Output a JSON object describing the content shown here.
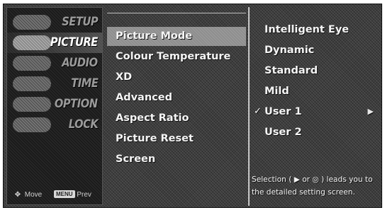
{
  "sidebar": {
    "categories": [
      {
        "label": "SETUP",
        "icon": "setup-icon"
      },
      {
        "label": "PICTURE",
        "icon": "picture-icon",
        "active": true
      },
      {
        "label": "AUDIO",
        "icon": "audio-icon"
      },
      {
        "label": "TIME",
        "icon": "time-icon"
      },
      {
        "label": "OPTION",
        "icon": "option-icon"
      },
      {
        "label": "LOCK",
        "icon": "lock-icon"
      }
    ]
  },
  "footer": {
    "move_icon": "✥",
    "move_label": "Move",
    "menu_badge": "MENU",
    "prev_label": "Prev"
  },
  "menu": {
    "items": [
      {
        "label": "Picture Mode",
        "selected": true
      },
      {
        "label": "Colour Temperature"
      },
      {
        "label": "XD"
      },
      {
        "label": "Advanced"
      },
      {
        "label": "Aspect Ratio"
      },
      {
        "label": "Picture Reset"
      },
      {
        "label": "Screen"
      }
    ]
  },
  "submenu": {
    "items": [
      {
        "label": "Intelligent Eye"
      },
      {
        "label": "Dynamic"
      },
      {
        "label": "Standard"
      },
      {
        "label": "Mild"
      },
      {
        "label": "User 1",
        "checked": true,
        "check_glyph": "✓",
        "arrow_glyph": "▶"
      },
      {
        "label": "User 2"
      }
    ]
  },
  "help": {
    "line1": "Selection ( ▶ or ◎ ) leads you  to",
    "line2": "the detailed setting screen."
  }
}
